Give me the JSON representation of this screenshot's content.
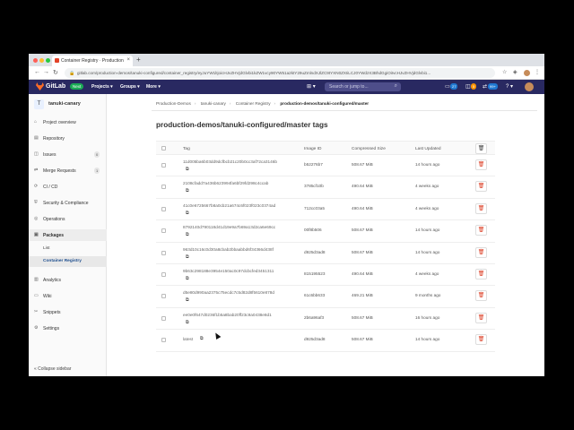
{
  "browser": {
    "tab_title": "Container Registry · Production",
    "tab_close": "×",
    "new_tab": "+",
    "url": "gitlab.com/production-demos/tanuki-configured/container_registry/eyJuYW1lIjoicHJvZHVjdGlvbi1kZW1vcy90YW51a2ktY29uZmlndXJlZC9tYXN0ZXIiLCJ0YWdzX3BhdGgiOiIvcHJvZHVjdGlvbi1..."
  },
  "header": {
    "brand": "GitLab",
    "badge": "Next",
    "nav": [
      "Projects ▾",
      "Groups ▾",
      "More ▾"
    ],
    "plus": "⊞ ▾",
    "search_placeholder": "Search or jump to...",
    "counts": [
      "27",
      "5",
      "99+"
    ],
    "help": "? ▾"
  },
  "sidebar": {
    "project_initial": "T",
    "project_name": "tanuki-canary",
    "items": [
      {
        "label": "Project overview",
        "icon": "⌂"
      },
      {
        "label": "Repository",
        "icon": "▤"
      },
      {
        "label": "Issues",
        "icon": "◫",
        "count": "0"
      },
      {
        "label": "Merge Requests",
        "icon": "⇄",
        "count": "1"
      },
      {
        "label": "CI / CD",
        "icon": "⟳"
      },
      {
        "label": "Security & Compliance",
        "icon": "⛨"
      },
      {
        "label": "Operations",
        "icon": "◎"
      },
      {
        "label": "Packages",
        "icon": "▣"
      }
    ],
    "subitems": [
      "List",
      "Container Registry"
    ],
    "items2": [
      {
        "label": "Analytics",
        "icon": "▥"
      },
      {
        "label": "Wiki",
        "icon": "▭"
      },
      {
        "label": "Snippets",
        "icon": "✂"
      },
      {
        "label": "Settings",
        "icon": "⚙"
      }
    ],
    "collapse": "«  Collapse sidebar"
  },
  "breadcrumbs": [
    "Production-Demos",
    "tanuki-canary",
    "Container Registry",
    "production-demos/tanuki-configured/master"
  ],
  "page_title": "production-demos/tanuki-configured/master tags",
  "table": {
    "headers": [
      "Tag",
      "Image ID",
      "Compressed Size",
      "Last Updated"
    ],
    "rows": [
      {
        "tag": "11d005ba6b03dd9dcfbcb21c20b0cc3af72ca3146b",
        "image": "b52276b7",
        "size": "508.67 MiB",
        "updated": "14 hours ago"
      },
      {
        "tag": "2108cfadd7a436b623994fa6bf29fd298c4ccab",
        "image": "3785cf10b",
        "size": "490.64 MiB",
        "updated": "4 weeks ago"
      },
      {
        "tag": "41c0e6725667b8a0cb21a674c6f023f023c0374ad",
        "image": "712cc03a5",
        "size": "490.64 MiB",
        "updated": "4 weeks ago"
      },
      {
        "tag": "8792140d790118d41d19e9a7b69a13d2ca6e69cc",
        "image": "00f8b506",
        "size": "508.67 MiB",
        "updated": "14 hours ago"
      },
      {
        "tag": "963d10c16c0d30a8cbab2bbaabbd6f34366d438f",
        "image": "d925d3ad8",
        "size": "508.67 MiB",
        "updated": "14 hours ago"
      },
      {
        "tag": "9b63c298188e3954e150ac0c97dcbcfed3451311",
        "image": "815195523",
        "size": "490.64 MiB",
        "updated": "4 weeks ago"
      },
      {
        "tag": "d5e80d990aa2375c75ecdc7c5d82d8f5610e878d",
        "image": "61c6bb633",
        "size": "469.21 MiB",
        "updated": "9 months ago"
      },
      {
        "tag": "ee0e0f647d0236f1b5a8bab20ff23c9a0438e8d1",
        "image": "2b6a96af3",
        "size": "508.67 MiB",
        "updated": "16 hours ago"
      },
      {
        "tag": "latest",
        "image": "d925d3ad8",
        "size": "508.67 MiB",
        "updated": "14 hours ago"
      }
    ]
  },
  "icons": {
    "copy": "⧉",
    "trash": "🗑",
    "lock": "🔒",
    "search": "⌕"
  }
}
